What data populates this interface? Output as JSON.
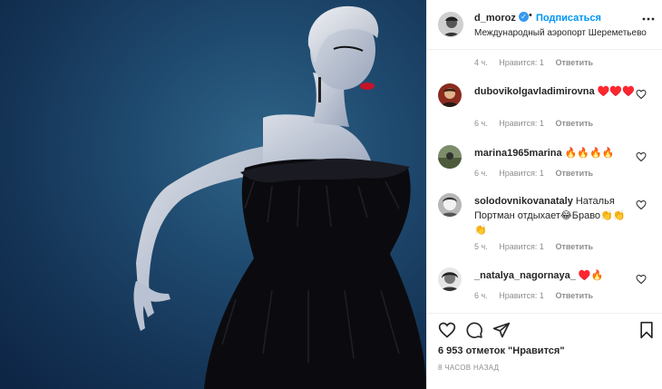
{
  "post": {
    "username": "d_moroz",
    "follow_label": "Подписаться",
    "separator": "•",
    "location": "Международный аэропорт Шереметьево",
    "photo_icon": "photo-woman-black-feather-dress",
    "verified_icon": "✓"
  },
  "first_comment_meta": {
    "time": "4 ч.",
    "likes": "Нравится: 1",
    "reply": "Ответить"
  },
  "comments": [
    {
      "username": "dubovikolgavladimirovna",
      "text": "♥️♥️♥️",
      "time": "6 ч.",
      "likes": "Нравится: 1",
      "reply": "Ответить"
    },
    {
      "username": "marina1965marina",
      "text": "🔥🔥🔥🔥",
      "time": "6 ч.",
      "likes": "Нравится: 1",
      "reply": "Ответить"
    },
    {
      "username": "solodovnikovanataly",
      "text": "Наталья Портман отдыхает😂Браво👏👏👏",
      "time": "5 ч.",
      "likes": "Нравится: 1",
      "reply": "Ответить"
    },
    {
      "username": "_natalya_nagornaya_",
      "text": "♥️🔥",
      "time": "6 ч.",
      "likes": "Нравится: 1",
      "reply": "Ответить"
    }
  ],
  "actions": {
    "likes_count": "6 953 отметок \"Нравится\"",
    "timestamp": "8 ЧАСОВ НАЗАД"
  },
  "colors": {
    "link_blue": "#0095f6",
    "muted": "#8e8e8e",
    "text": "#262626",
    "heart_red": "#ed4956"
  }
}
